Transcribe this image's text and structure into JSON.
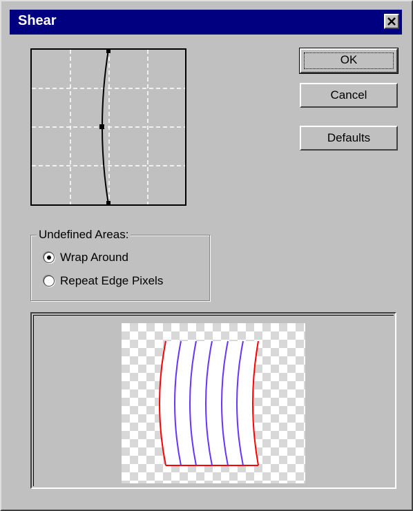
{
  "dialog": {
    "title": "Shear",
    "close_symbol": "close-icon"
  },
  "buttons": {
    "ok_label": "OK",
    "cancel_label": "Cancel",
    "defaults_label": "Defaults"
  },
  "undefined_areas": {
    "legend": "Undefined Areas:",
    "options": [
      {
        "label": "Wrap Around",
        "selected": true
      },
      {
        "label": "Repeat Edge Pixels",
        "selected": false
      }
    ]
  },
  "colors": {
    "title_bar": "#000080",
    "preview_edge": "#ff0000",
    "preview_lines": "#6633ff"
  }
}
